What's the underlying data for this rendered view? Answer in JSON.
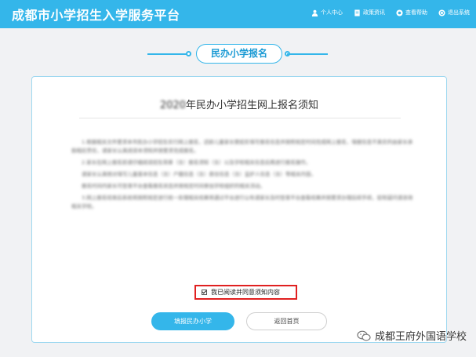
{
  "header": {
    "title": "成都市小学招生入学服务平台",
    "nav": [
      {
        "label": "个人中心",
        "icon": "user-icon"
      },
      {
        "label": "政策资讯",
        "icon": "document-icon"
      },
      {
        "label": "查看帮助",
        "icon": "help-icon"
      },
      {
        "label": "退出系统",
        "icon": "logout-icon"
      }
    ]
  },
  "banner": {
    "label": "民办小学报名"
  },
  "notice": {
    "title_year": "2020",
    "title": "年民办小学招生网上报名须知",
    "paragraphs": [
      "1.根据相关文件要求本市民办小学招生实行网上报名，适龄儿童家长需如实填写报名信息并按照规定时间完成网上报名，填报信息不真实的由家长承担相应责任，请家长认真阅读本须知并按要求完成报名。",
      "2.家长在网上报名前请仔细阅读招生简章（含）报名须知（含）以及学校相关信息后再进行报名操作。",
      "请家长认真核对填写儿童基本信息（含）户籍信息（含）居住信息（含）监护人信息（含）等相关内容。",
      "报名时间内家长可登录平台查看报名状态并按规定时间参加学校组织的相关活动。",
      "3.网上报名结束后系统将按照规定进行统一处理相关结果将通过平台进行公布请家长及时登录平台查看结果并按要求办理后续手续，如有疑问请咨询相关学校。"
    ]
  },
  "agreement": {
    "label": "我已阅读并同意须知内容",
    "checked": true
  },
  "buttons": {
    "primary": "填报民办小学",
    "secondary": "返回首页"
  },
  "watermark": {
    "text": "成都王府外国语学校"
  },
  "colors": {
    "accent": "#34b6ea",
    "highlight": "#e02020"
  }
}
